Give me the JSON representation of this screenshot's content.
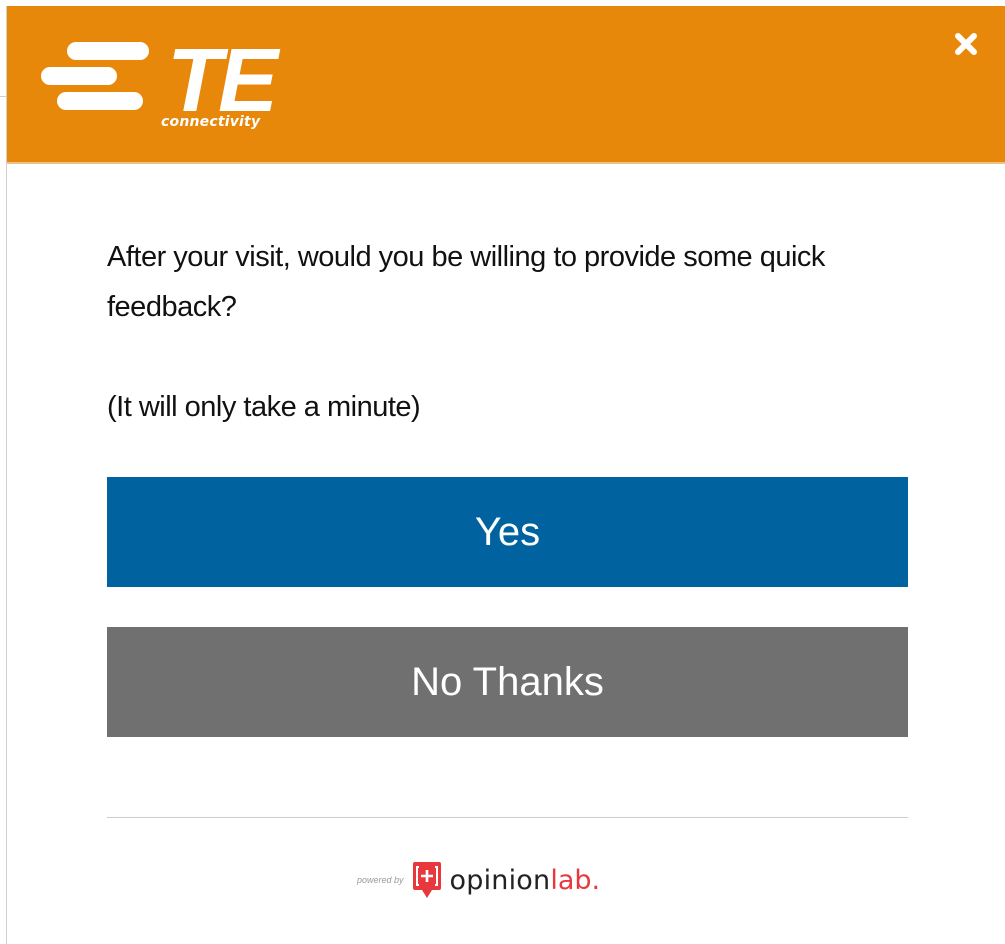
{
  "header": {
    "brand": "TE",
    "tagline": "connectivity",
    "close_icon": "close-icon",
    "background_color": "#e8880a"
  },
  "survey": {
    "question": "After your visit, would you be willing to provide some quick feedback?",
    "note": "(It will only take a minute)",
    "yes_label": "Yes",
    "no_label": "No Thanks",
    "yes_color": "#00639f",
    "no_color": "#707070"
  },
  "footer": {
    "powered_by": "powered by",
    "brand_main": "opinion",
    "brand_accent": "lab.",
    "logo_icon": "opinionlab-plus-icon"
  }
}
